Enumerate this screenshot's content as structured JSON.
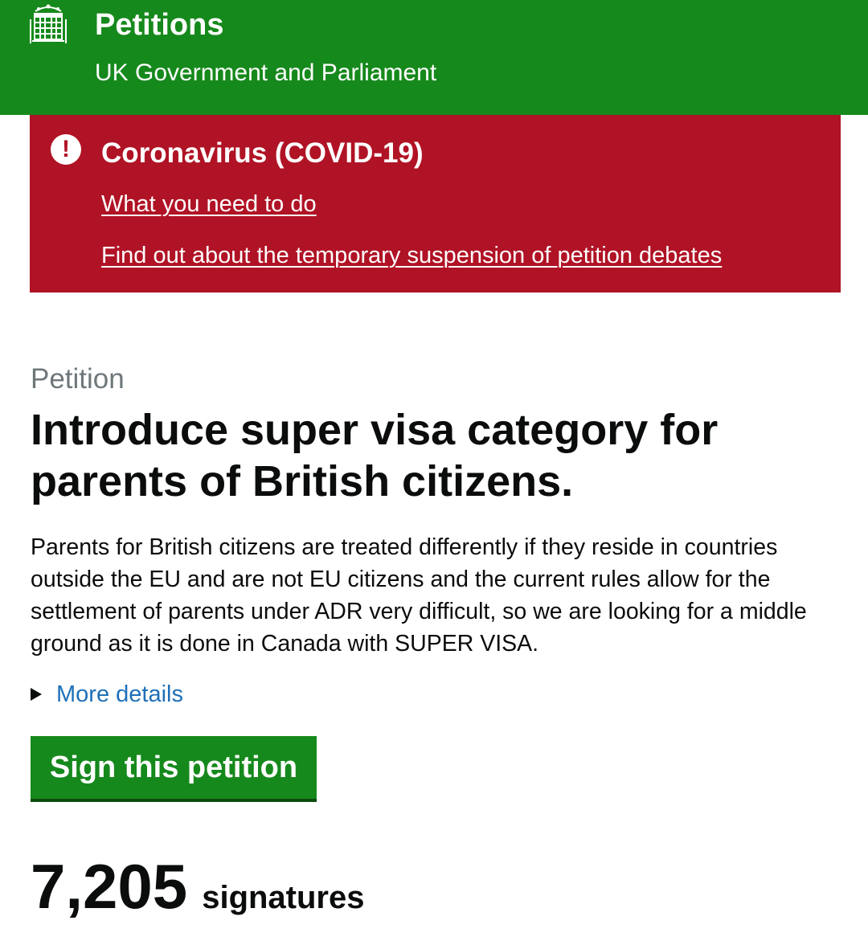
{
  "header": {
    "title": "Petitions",
    "subtitle": "UK Government and Parliament",
    "crest_icon": "portcullis-icon",
    "background": "#16891c"
  },
  "alert": {
    "icon": "exclamation-icon",
    "title": "Coronavirus (COVID-19)",
    "links": [
      "What you need to do",
      "Find out about the temporary suspension of petition debates"
    ],
    "background": "#b01325"
  },
  "petition": {
    "caption": "Petition",
    "title": "Introduce super visa category for parents of British citizens.",
    "description": "Parents for British citizens are treated differently if they reside in countries outside the EU and are not EU citizens and the current rules allow for the settlement of parents under ADR very difficult, so we are looking for a middle ground as it is done in Canada with SUPER VISA.",
    "more_details_label": "More details",
    "sign_button_label": "Sign this petition",
    "signature_count": "7,205",
    "signature_label": "signatures"
  }
}
